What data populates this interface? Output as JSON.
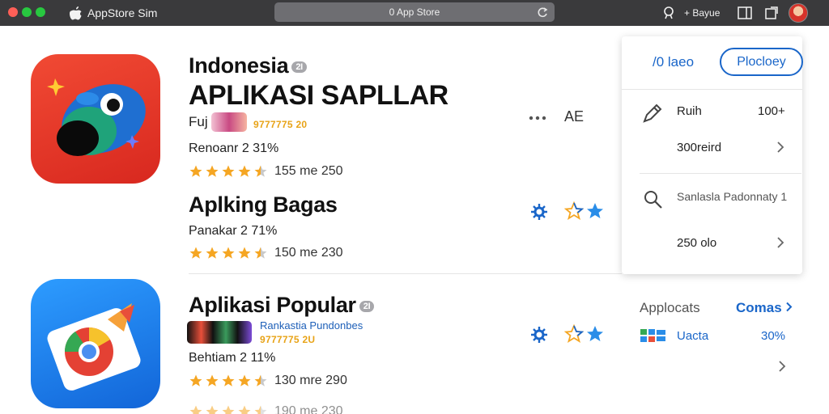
{
  "titlebar": {
    "app_name": "AppStore Sim",
    "url": "0 App Store",
    "right_label": "+ Bayue"
  },
  "apps": [
    {
      "title": "Indonesia",
      "badge": "2I",
      "headline": "APLIKASI SAPLLAR",
      "developer_prefix": "Fuj",
      "developer_sub": "9777775 20",
      "rating_text": "Renoanr 2 31%",
      "stars_count": "155 me 250",
      "star_value": 4.5
    },
    {
      "title": "Aplking Bagas",
      "rating_text": "Panakar 2 71%",
      "stars_count": "150 me 230",
      "star_value": 4.5
    },
    {
      "title": "Aplikasi Popular",
      "badge": "2I",
      "developer_name": "Rankastia Pundonbes",
      "developer_sub": "9777775 2U",
      "rating_text": "Behtiam 2 11%",
      "stars_count": "130 mre 290",
      "star_value": 4.5,
      "partial_count": "190 me 230"
    }
  ],
  "row_actions": {
    "more_text": "AE"
  },
  "panel": {
    "link": "/0 laeo",
    "button": "Plocloey",
    "rows": [
      {
        "label": "Ruih",
        "value": "100+"
      },
      {
        "label": "300reird"
      },
      {
        "label": "Sanlasla Padonnaty 1"
      },
      {
        "label": "250 olo"
      }
    ]
  },
  "lower_panel": {
    "label": "Applocats",
    "link": "Comas",
    "item_label": "Uacta",
    "item_value": "30%"
  },
  "colors": {
    "accent": "#1a66c9",
    "star": "#f5a623",
    "titlebar": "#3a3a3c"
  }
}
